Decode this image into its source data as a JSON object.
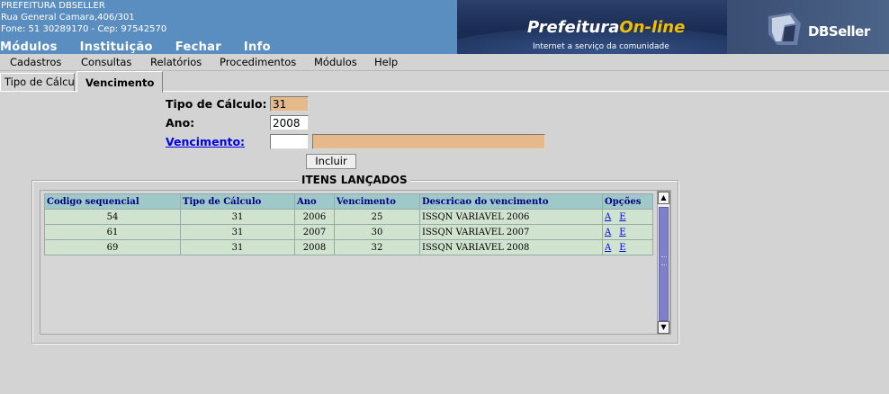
{
  "org": {
    "name": "PREFEITURA DBSELLER",
    "address": "Rua General Camara,406/301",
    "contact": "Fone: 51 30289170  -  Cep: 97542570"
  },
  "top_menu": [
    "Módulos",
    "Instituição",
    "Fechar",
    "Info"
  ],
  "banner": {
    "title_main": "Prefeitura",
    "title_accent": "On-line",
    "subtitle": "Internet a serviço da comunidade",
    "logo_text": "DBSeller"
  },
  "menubar": [
    "Cadastros",
    "Consultas",
    "Relatórios",
    "Procedimentos",
    "Módulos",
    "Help"
  ],
  "tabs": [
    "Tipo de Cálculo",
    "Vencimento"
  ],
  "form": {
    "tipo_calculo_label": "Tipo de Cálculo:",
    "tipo_calculo_value": "31",
    "ano_label": "Ano:",
    "ano_value": "2008",
    "vencimento_label": "Vencimento:",
    "vencimento_code": "",
    "vencimento_desc": "",
    "incluir_label": "Incluir"
  },
  "section_title": "ITENS LANÇADOS",
  "table": {
    "headers": [
      "Codigo sequencial",
      "Tipo de Cálculo",
      "Ano",
      "Vencimento",
      "Descricao do vencimento",
      "Opções"
    ],
    "rows": [
      {
        "codigo": "54",
        "tipo": "31",
        "ano": "2006",
        "venc": "25",
        "desc": "ISSQN VARIAVEL 2006",
        "a": "A",
        "e": "E"
      },
      {
        "codigo": "61",
        "tipo": "31",
        "ano": "2007",
        "venc": "30",
        "desc": "ISSQN VARIAVEL 2007",
        "a": "A",
        "e": "E"
      },
      {
        "codigo": "69",
        "tipo": "31",
        "ano": "2008",
        "venc": "32",
        "desc": "ISSQN VARIAVEL 2008",
        "a": "A",
        "e": "E"
      }
    ]
  },
  "icons": {
    "scroll_up": "scroll-up-arrow-icon",
    "scroll_down": "scroll-down-arrow-icon"
  },
  "colors": {
    "header_blue": "#5b8ec0",
    "readonly_field": "#e6b98a",
    "table_header": "#9fc8c8",
    "table_row": "#cfe3cf",
    "scroll_thumb": "#8080c8"
  }
}
